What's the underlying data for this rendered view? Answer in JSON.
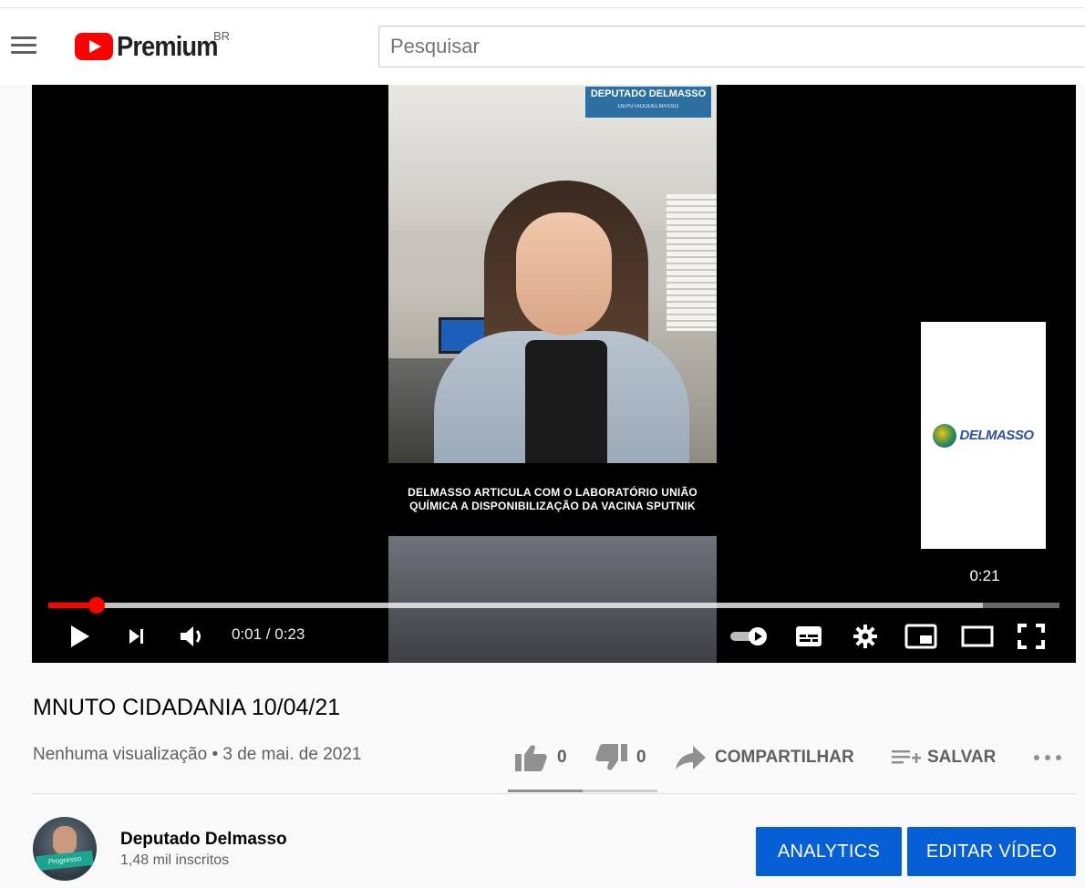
{
  "header": {
    "logo_text": "Premium",
    "region": "BR",
    "search_placeholder": "Pesquisar"
  },
  "player": {
    "brand_badge_title": "DEPUTADO DELMASSO",
    "brand_badge_sub": "DEPUTADODELMASSO",
    "caption_line1": "DELMASSO ARTICULA COM O LABORATÓRIO UNIÃO",
    "caption_line2": "QUÍMICA A DISPONIBILIZAÇÃO DA VACINA SPUTNIK",
    "preview_logo_text": "DELMASSO",
    "preview_time": "0:21",
    "current_time": "0:01",
    "duration": "0:23",
    "time_display": "0:01 / 0:23",
    "progress_played_fraction": 0.048,
    "progress_loaded_fraction": 0.924
  },
  "video": {
    "title": "MNUTO CIDADANIA 10/04/21",
    "views": "Nenhuma visualização",
    "separator": "•",
    "date": "3 de mai. de 2021",
    "meta_line": "Nenhuma visualização • 3 de mai. de 2021",
    "likes": "0",
    "dislikes": "0",
    "share_label": "COMPARTILHAR",
    "save_label": "SALVAR"
  },
  "channel": {
    "name": "Deputado Delmasso",
    "subscribers": "1,48 mil inscritos",
    "avatar_text": "Progresso"
  },
  "buttons": {
    "analytics": "ANALYTICS",
    "edit_video": "EDITAR VÍDEO"
  },
  "colors": {
    "accent_red": "#ff0000",
    "button_blue": "#065fd4",
    "text_secondary": "#606060"
  },
  "icons": [
    "menu-icon",
    "youtube-logo-icon",
    "play-icon",
    "next-icon",
    "volume-icon",
    "autoplay-toggle-icon",
    "subtitles-icon",
    "settings-icon",
    "miniplayer-icon",
    "theater-mode-icon",
    "fullscreen-icon",
    "like-icon",
    "dislike-icon",
    "share-icon",
    "save-playlist-icon",
    "more-icon"
  ]
}
